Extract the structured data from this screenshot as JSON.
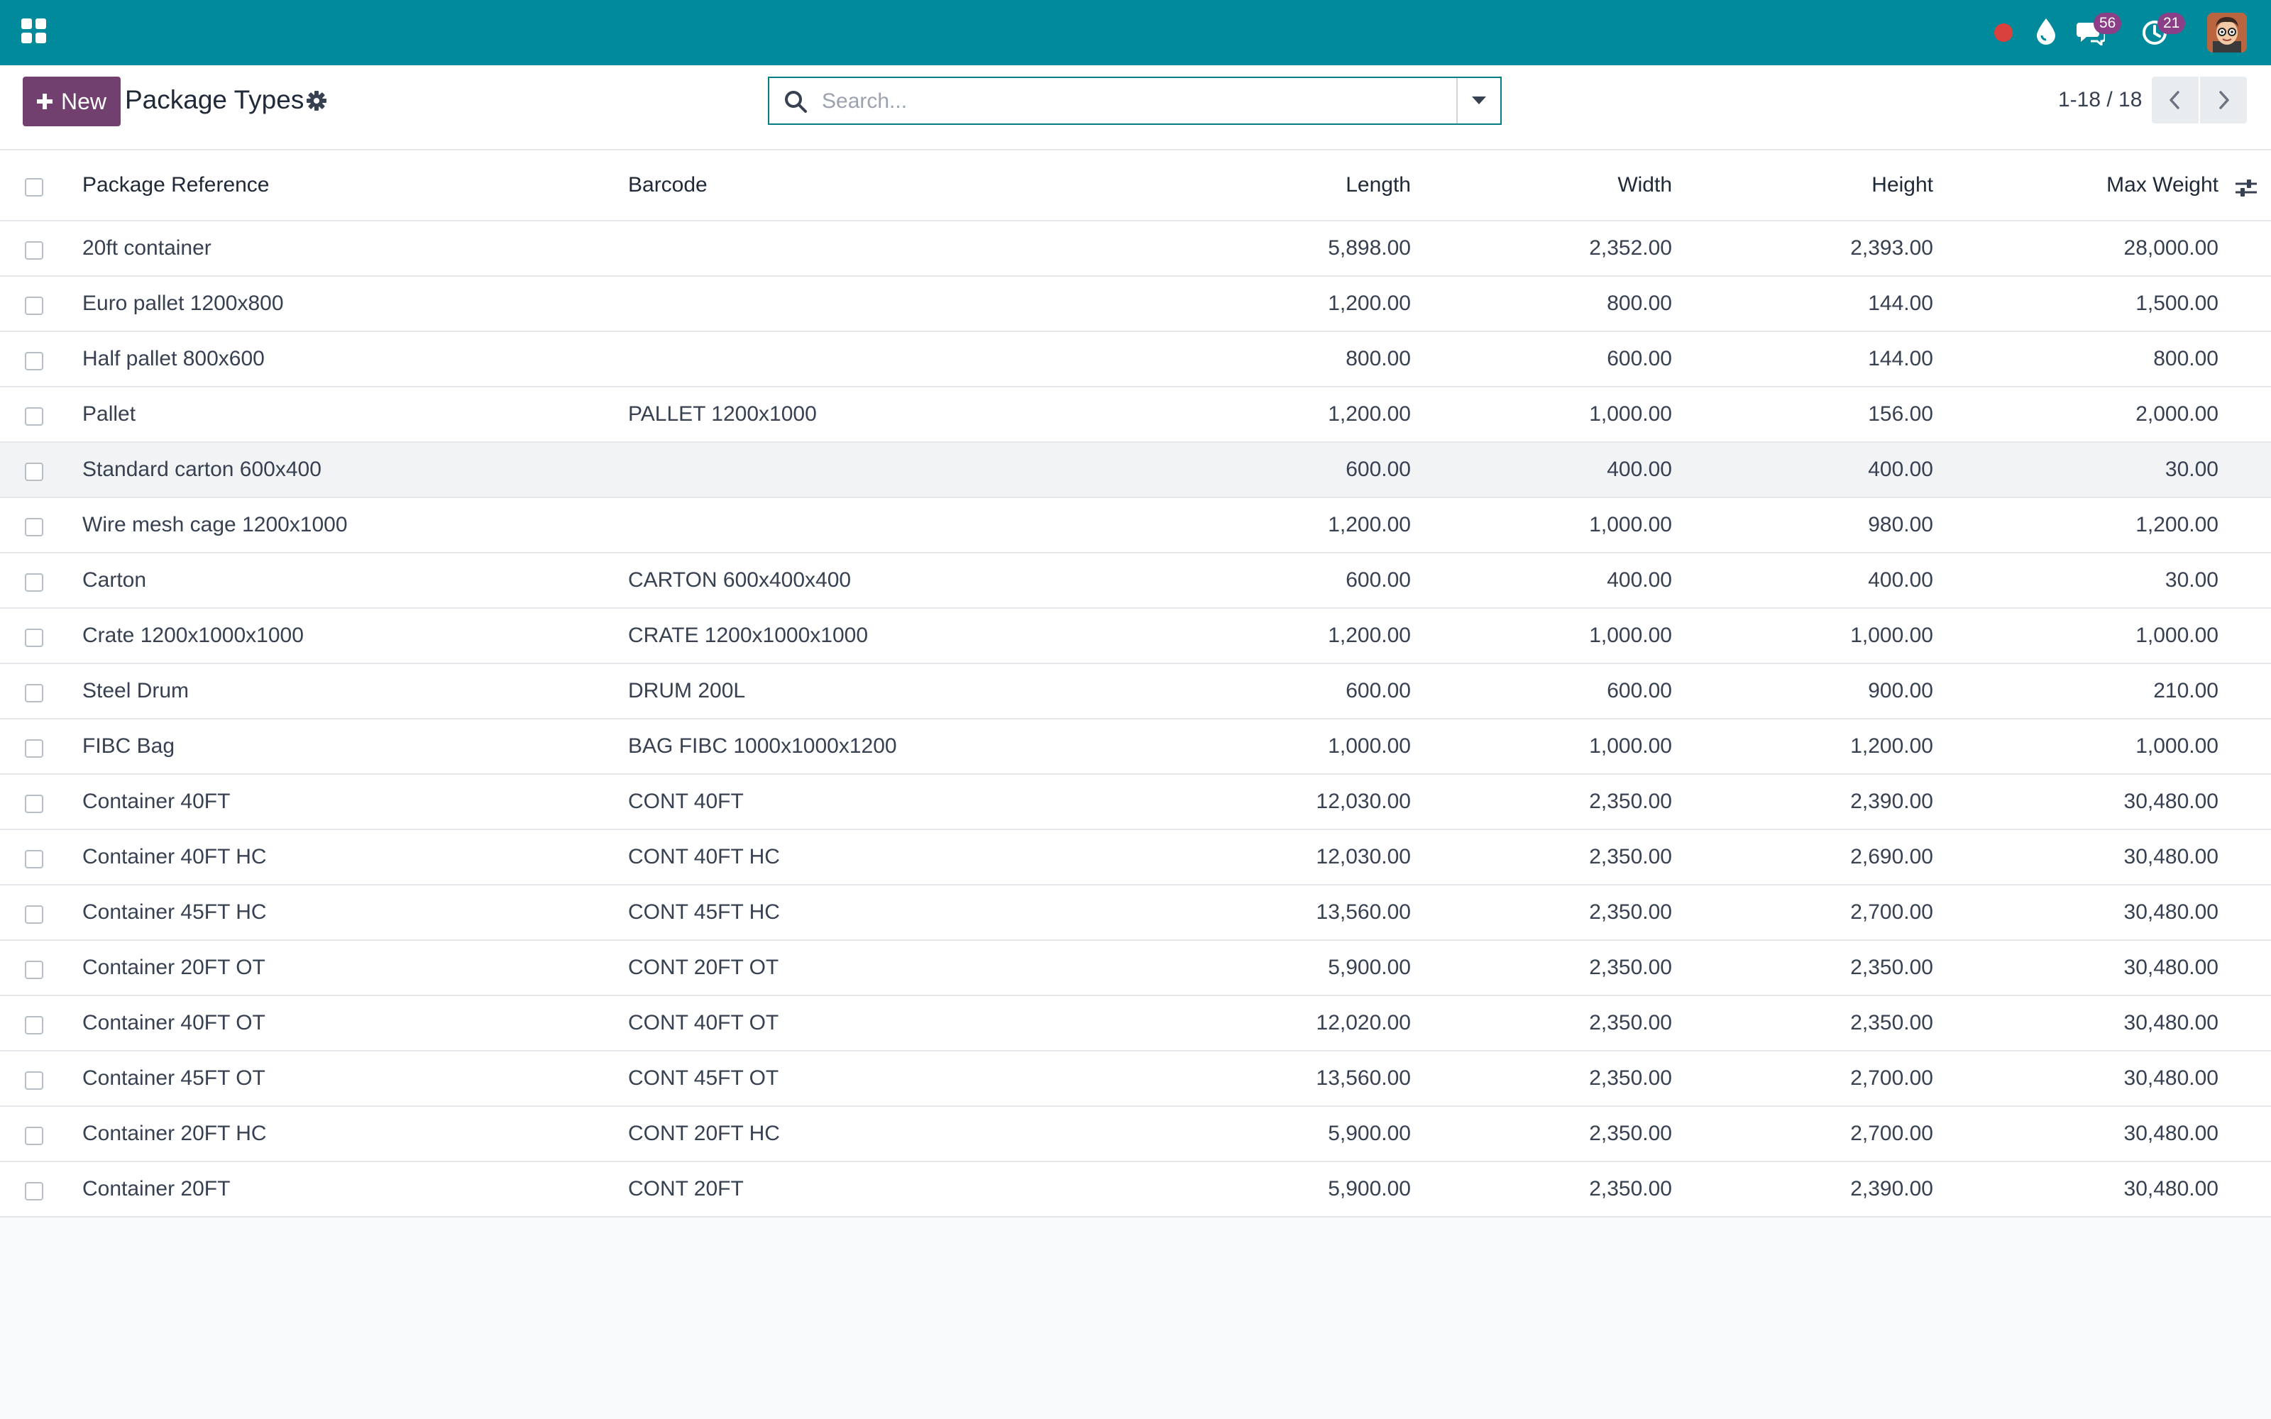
{
  "navbar": {
    "messages_count": "56",
    "activities_count": "21",
    "brand_color": "#018a9b"
  },
  "control_panel": {
    "new_label": "New",
    "title": "Package Types",
    "search_placeholder": "Search...",
    "pager": "1-18 / 18"
  },
  "table": {
    "columns": {
      "name": "Package Reference",
      "barcode": "Barcode",
      "length": "Length",
      "width": "Width",
      "height": "Height",
      "max_weight": "Max Weight"
    },
    "rows": [
      {
        "name": "20ft container",
        "barcode": "",
        "length": "5,898.00",
        "width": "2,352.00",
        "height": "2,393.00",
        "max_weight": "28,000.00"
      },
      {
        "name": "Euro pallet 1200x800",
        "barcode": "",
        "length": "1,200.00",
        "width": "800.00",
        "height": "144.00",
        "max_weight": "1,500.00"
      },
      {
        "name": "Half pallet 800x600",
        "barcode": "",
        "length": "800.00",
        "width": "600.00",
        "height": "144.00",
        "max_weight": "800.00"
      },
      {
        "name": "Pallet",
        "barcode": "PALLET 1200x1000",
        "length": "1,200.00",
        "width": "1,000.00",
        "height": "156.00",
        "max_weight": "2,000.00"
      },
      {
        "name": "Standard carton 600x400",
        "barcode": "",
        "length": "600.00",
        "width": "400.00",
        "height": "400.00",
        "max_weight": "30.00"
      },
      {
        "name": "Wire mesh cage 1200x1000",
        "barcode": "",
        "length": "1,200.00",
        "width": "1,000.00",
        "height": "980.00",
        "max_weight": "1,200.00"
      },
      {
        "name": "Carton",
        "barcode": "CARTON 600x400x400",
        "length": "600.00",
        "width": "400.00",
        "height": "400.00",
        "max_weight": "30.00"
      },
      {
        "name": "Crate 1200x1000x1000",
        "barcode": "CRATE 1200x1000x1000",
        "length": "1,200.00",
        "width": "1,000.00",
        "height": "1,000.00",
        "max_weight": "1,000.00"
      },
      {
        "name": "Steel Drum",
        "barcode": "DRUM 200L",
        "length": "600.00",
        "width": "600.00",
        "height": "900.00",
        "max_weight": "210.00"
      },
      {
        "name": "FIBC Bag",
        "barcode": "BAG FIBC 1000x1000x1200",
        "length": "1,000.00",
        "width": "1,000.00",
        "height": "1,200.00",
        "max_weight": "1,000.00"
      },
      {
        "name": "Container 40FT",
        "barcode": "CONT 40FT",
        "length": "12,030.00",
        "width": "2,350.00",
        "height": "2,390.00",
        "max_weight": "30,480.00"
      },
      {
        "name": "Container 40FT HC",
        "barcode": "CONT 40FT HC",
        "length": "12,030.00",
        "width": "2,350.00",
        "height": "2,690.00",
        "max_weight": "30,480.00"
      },
      {
        "name": "Container 45FT HC",
        "barcode": "CONT 45FT HC",
        "length": "13,560.00",
        "width": "2,350.00",
        "height": "2,700.00",
        "max_weight": "30,480.00"
      },
      {
        "name": "Container 20FT OT",
        "barcode": "CONT 20FT OT",
        "length": "5,900.00",
        "width": "2,350.00",
        "height": "2,350.00",
        "max_weight": "30,480.00"
      },
      {
        "name": "Container 40FT OT",
        "barcode": "CONT 40FT OT",
        "length": "12,020.00",
        "width": "2,350.00",
        "height": "2,350.00",
        "max_weight": "30,480.00"
      },
      {
        "name": "Container 45FT OT",
        "barcode": "CONT 45FT OT",
        "length": "13,560.00",
        "width": "2,350.00",
        "height": "2,700.00",
        "max_weight": "30,480.00"
      },
      {
        "name": "Container 20FT HC",
        "barcode": "CONT 20FT HC",
        "length": "5,900.00",
        "width": "2,350.00",
        "height": "2,700.00",
        "max_weight": "30,480.00"
      },
      {
        "name": "Container 20FT",
        "barcode": "CONT 20FT",
        "length": "5,900.00",
        "width": "2,350.00",
        "height": "2,390.00",
        "max_weight": "30,480.00"
      }
    ]
  }
}
